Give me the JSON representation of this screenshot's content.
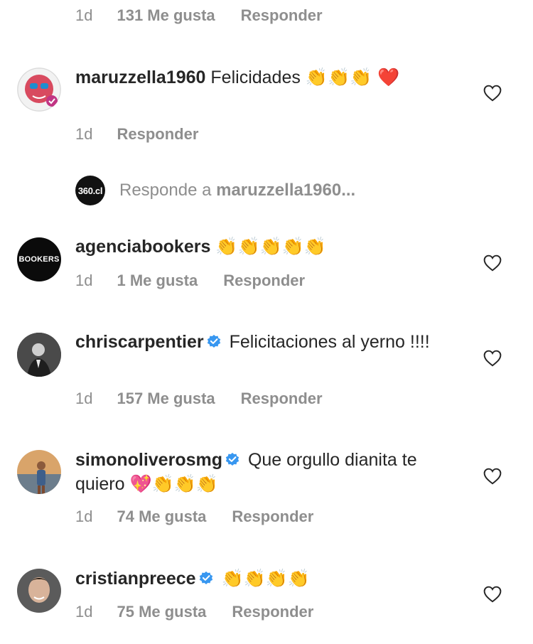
{
  "top_comment_meta": {
    "ago": "1d",
    "likes": "131 Me gusta",
    "reply": "Responder"
  },
  "comments": [
    {
      "username": "maruzzella1960",
      "verified": false,
      "text": "Felicidades",
      "emoji": "👏👏👏 ❤️",
      "ago": "1d",
      "likes": "",
      "reply": "Responder"
    },
    {
      "username": "agenciabookers",
      "verified": false,
      "text": "",
      "emoji": "👏👏👏👏👏",
      "ago": "1d",
      "likes": "1 Me gusta",
      "reply": "Responder",
      "avatar_text": "BOOKERS"
    },
    {
      "username": "chriscarpentier",
      "verified": true,
      "text": "Felicitaciones al yerno !!!!",
      "emoji": "",
      "ago": "1d",
      "likes": "157 Me gusta",
      "reply": "Responder"
    },
    {
      "username": "simonoliverosmg",
      "verified": true,
      "text": "Que orgullo dianita te quiero",
      "emoji": "💖👏👏👏",
      "ago": "1d",
      "likes": "74 Me gusta",
      "reply": "Responder"
    },
    {
      "username": "cristianpreece",
      "verified": true,
      "text": "",
      "emoji": "👏👏👏👏",
      "ago": "1d",
      "likes": "75 Me gusta",
      "reply": "Responder"
    }
  ],
  "reply_field": {
    "avatar_text": "360.cl",
    "prefix": "Responde a",
    "target": "maruzzella1960..."
  },
  "icons": {
    "like": "heart-outline-icon",
    "verified": "verified-badge-icon"
  },
  "colors": {
    "text": "#262626",
    "secondary": "#8e8e8e",
    "verified": "#3897f0"
  }
}
